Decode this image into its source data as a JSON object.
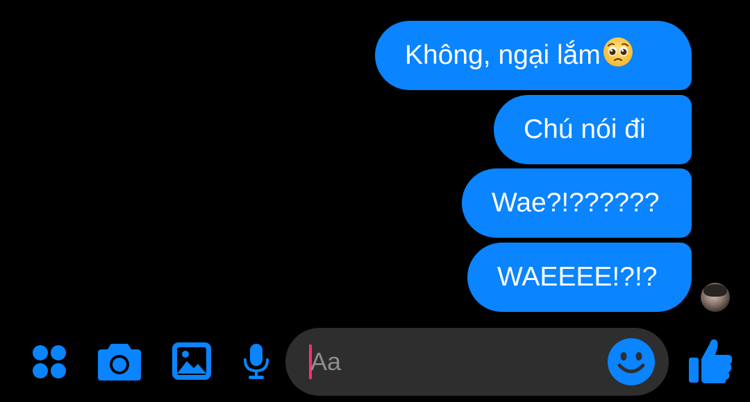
{
  "messages": [
    {
      "text": "Không, ngại lắm",
      "emoji": "pleading-face"
    },
    {
      "text": "Chú nói đi"
    },
    {
      "text": "Wae?!??????"
    },
    {
      "text": "WAEEEE!?!?"
    }
  ],
  "composer": {
    "placeholder": "Aa"
  },
  "toolbar": {
    "icons": [
      "apps-grid-icon",
      "camera-icon",
      "gallery-icon",
      "microphone-icon",
      "emoji-icon",
      "thumbs-up-icon"
    ]
  },
  "colors": {
    "accent": "#0a84ff",
    "background": "#000000",
    "input_background": "#2e2e2e",
    "caret": "#ff2d78"
  }
}
